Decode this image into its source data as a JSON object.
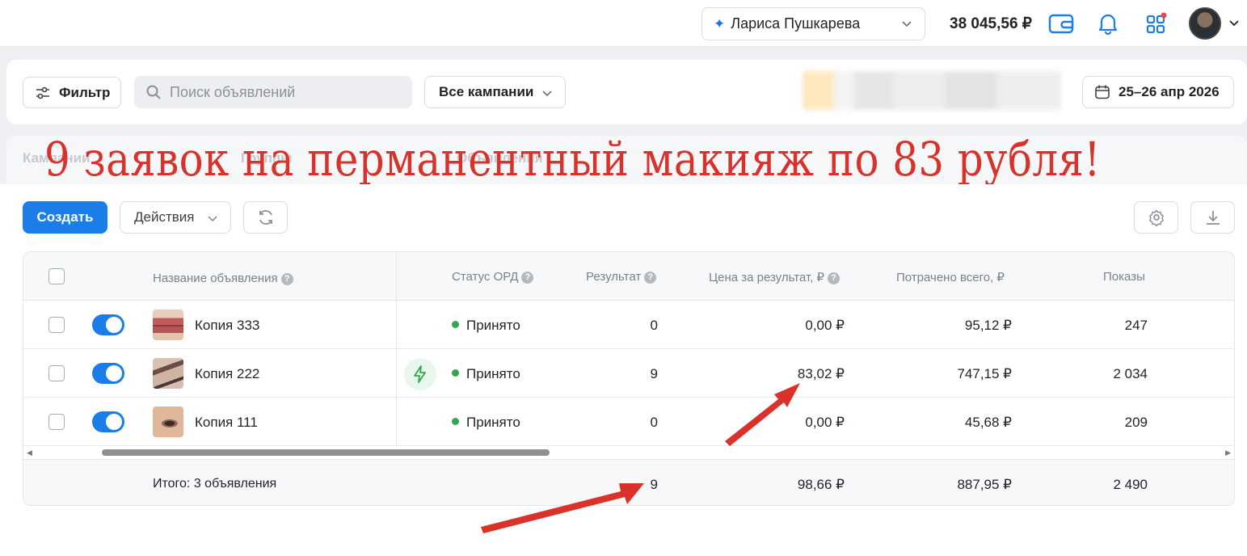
{
  "topbar": {
    "account_name": "Лариса Пушкарева",
    "balance": "38 045,56 ₽",
    "icons": [
      "wallet-icon",
      "bell-icon",
      "apps-grid-icon"
    ],
    "notification_dot_color": "#e5484d"
  },
  "filters": {
    "filter_label": "Фильтр",
    "search_placeholder": "Поиск объявлений",
    "campaigns_label": "Все кампании",
    "date_range": "25–26 апр 2026"
  },
  "tabs": [
    "Кампании",
    "Группы",
    "Объявления"
  ],
  "headline": "9 заявок на перманентный макияж по 83 рубля!",
  "toolbar": {
    "create_label": "Создать",
    "actions_label": "Действия"
  },
  "table": {
    "columns": {
      "name": "Название объявления",
      "status": "Статус ОРД",
      "result": "Результат",
      "cpr": "Цена за результат, ₽",
      "spent": "Потрачено всего, ₽",
      "impressions": "Показы"
    },
    "rows": [
      {
        "name": "Копия 333",
        "status": "Принято",
        "result": "0",
        "cpr": "0,00 ₽",
        "spent": "95,12 ₽",
        "impressions": "247",
        "active": true,
        "thumb": "lips"
      },
      {
        "name": "Копия 222",
        "status": "Принято",
        "result": "9",
        "cpr": "83,02 ₽",
        "spent": "747,15 ₽",
        "impressions": "2 034",
        "active": true,
        "thumb": "brows",
        "boosted": true
      },
      {
        "name": "Копия 111",
        "status": "Принято",
        "result": "0",
        "cpr": "0,00 ₽",
        "spent": "45,68 ₽",
        "impressions": "209",
        "active": true,
        "thumb": "eye"
      }
    ],
    "totals": {
      "label": "Итого: 3 объявления",
      "result": "9",
      "cpr": "98,66 ₽",
      "spent": "887,95 ₽",
      "impressions": "2 490"
    },
    "scroll_fraction": 0.38
  },
  "colors": {
    "accent": "#1a7de8",
    "status_ok": "#2fa84f",
    "annotation": "#d8322a"
  }
}
